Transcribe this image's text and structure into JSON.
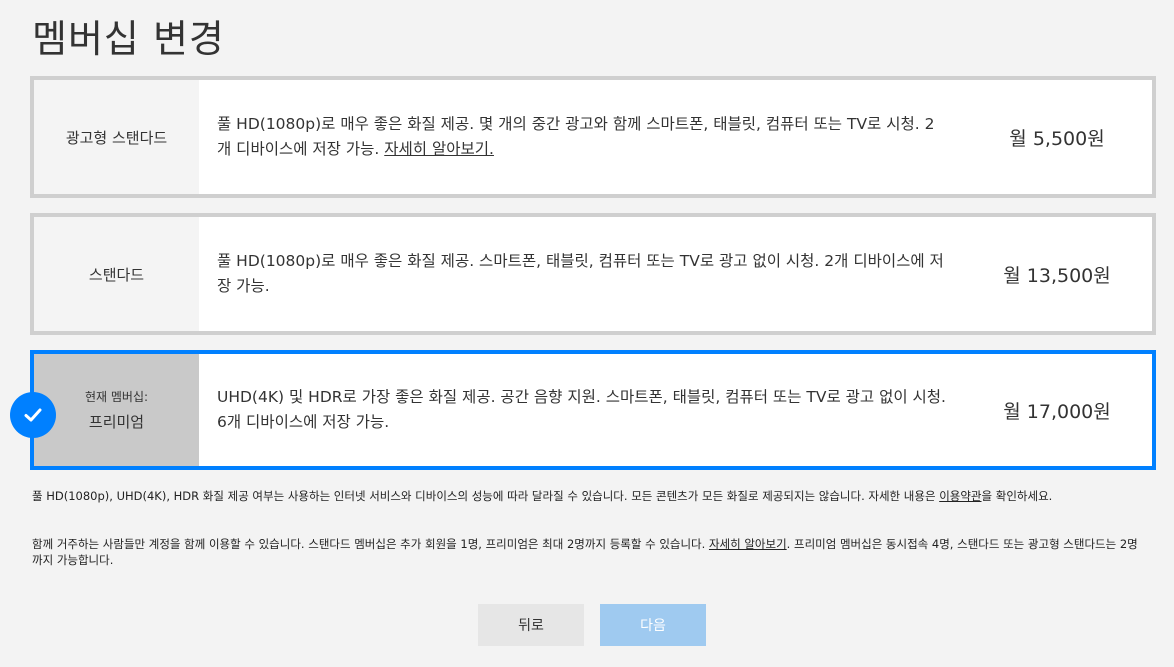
{
  "page": {
    "title": "멤버십 변경"
  },
  "plans": [
    {
      "name": "광고형 스탠다드",
      "description": "풀 HD(1080p)로 매우 좋은 화질 제공. 몇 개의 중간 광고와 함께 스마트폰, 태블릿, 컴퓨터 또는 TV로 시청. 2개 디바이스에 저장 가능. ",
      "link": "자세히 알아보기.",
      "price": "월 5,500원"
    },
    {
      "name": "스탠다드",
      "description": "풀 HD(1080p)로 매우 좋은 화질 제공. 스마트폰, 태블릿, 컴퓨터 또는 TV로 광고 없이 시청. 2개 디바이스에 저장 가능.",
      "price": "월 13,500원"
    },
    {
      "current_label": "현재 멤버십:",
      "name": "프리미엄",
      "description": "UHD(4K) 및 HDR로 가장 좋은 화질 제공. 공간 음향 지원. 스마트폰, 태블릿, 컴퓨터 또는 TV로 광고 없이 시청. 6개 디바이스에 저장 가능.",
      "price": "월 17,000원",
      "selected": true
    }
  ],
  "notes": {
    "quality_text": "풀 HD(1080p), UHD(4K), HDR 화질 제공 여부는 사용하는 인터넷 서비스와 디바이스의 성능에 따라 달라질 수 있습니다. 모든 콘텐츠가 모든 화질로 제공되지는 않습니다. 자세한 내용은 ",
    "quality_link": "이용약관",
    "quality_suffix": "을 확인하세요.",
    "household_text": "함께 거주하는 사람들만 계정을 함께 이용할 수 있습니다. 스탠다드 멤버십은 추가 회원을 1명, 프리미엄은 최대 2명까지 등록할 수 있습니다. ",
    "household_link": "자세히 알아보기",
    "household_suffix": ". 프리미엄 멤버십은 동시접속 4명, 스탠다드 또는 광고형 스탠다드는 2명까지 가능합니다."
  },
  "buttons": {
    "back": "뒤로",
    "next": "다음"
  },
  "colors": {
    "accent": "#0080ff",
    "next_disabled": "#9fcaf0",
    "border": "#cfcfcf"
  },
  "icons": {
    "selected": "check-circle-icon"
  }
}
